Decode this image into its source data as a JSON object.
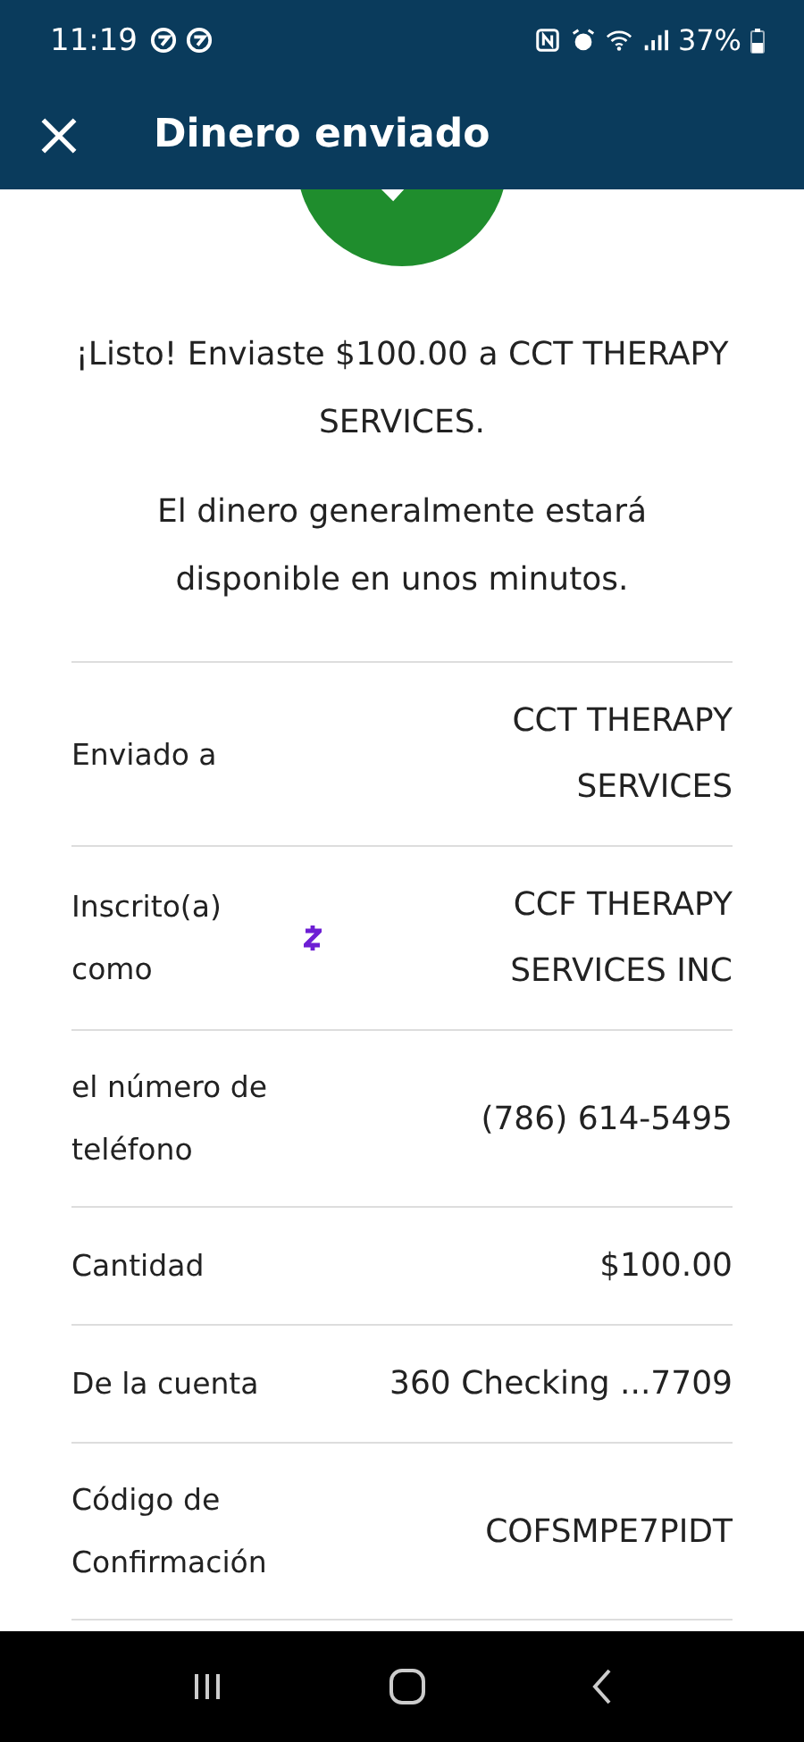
{
  "status_bar": {
    "time": "11:19",
    "battery": "37%"
  },
  "app_bar": {
    "title": "Dinero enviado"
  },
  "message": "¡Listo! Enviaste $100.00 a CCT THERAPY SERVICES.",
  "note": "El dinero generalmente estará disponible en unos minutos.",
  "details": [
    {
      "kind": "plain",
      "label": "Enviado a",
      "value": "CCT THERAPY SERVICES"
    },
    {
      "kind": "zelle",
      "label": "Inscrito(a) como",
      "value": "CCF THERAPY SERVICES INC"
    },
    {
      "kind": "plain",
      "label": "el número de teléfono",
      "value": "(786) 614-5495"
    },
    {
      "kind": "plain",
      "label": "Cantidad",
      "value": "$100.00"
    },
    {
      "kind": "plain",
      "label": "De la cuenta",
      "value": "360 Checking ...7709"
    },
    {
      "kind": "plain",
      "label": "Código de Confirmación",
      "value": "COFSMPE7PIDT"
    }
  ]
}
